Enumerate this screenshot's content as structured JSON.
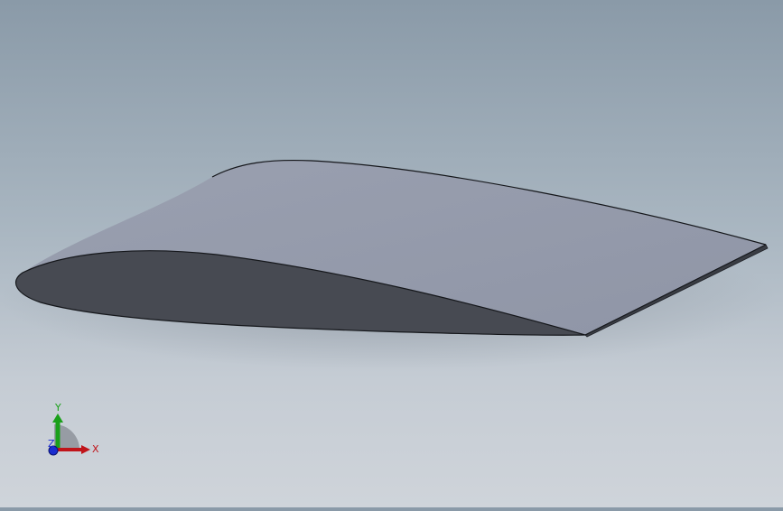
{
  "view": {
    "background_top": "#8a9aa8",
    "background_bottom": "#cfd4da",
    "model_top_face_color": "#9399aa",
    "model_end_face_color": "#474a52"
  },
  "triad": {
    "x_label": "X",
    "y_label": "Y",
    "z_label": "Z",
    "x_color": "#c0141a",
    "y_color": "#1aa01a",
    "z_color": "#1a2ccf"
  }
}
